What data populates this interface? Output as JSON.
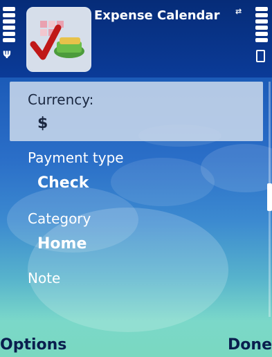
{
  "app": {
    "title": "Expense Calendar"
  },
  "form": {
    "currency": {
      "label": "Currency:",
      "value": "$"
    },
    "payment_type": {
      "label": "Payment type",
      "value": "Check"
    },
    "category": {
      "label": "Category",
      "value": "Home"
    },
    "note": {
      "label": "Note",
      "value": ""
    }
  },
  "softkeys": {
    "left": "Options",
    "right": "Done"
  },
  "icons": [
    "signal-strength-icon",
    "antenna-icon",
    "network-icon",
    "battery-icon",
    "app-icon"
  ]
}
